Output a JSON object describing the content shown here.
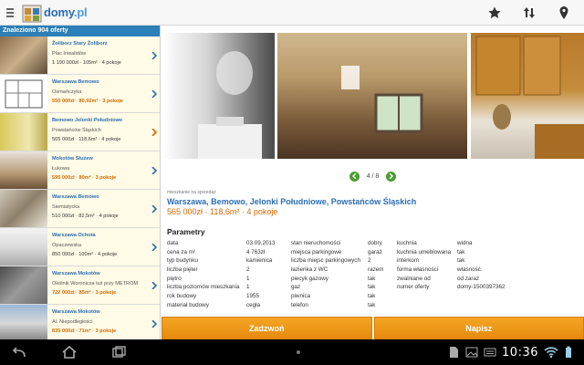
{
  "app": {
    "logo_text": "domy",
    "logo_suffix": ".pl"
  },
  "actionbar": {
    "icons": [
      "menu-icon",
      "star-icon",
      "sort-icon",
      "pin-icon"
    ]
  },
  "sidebar": {
    "header": "Znaleziono 904 oferty",
    "items": [
      {
        "title": "Żoliborz Stary Żoliborz",
        "sub": "Plac Inwalidów",
        "price": "1 190 000zł · 105m² · 4 pokoje",
        "highlight": false
      },
      {
        "title": "Warszawa Bemowo",
        "sub": "Osmańczyka",
        "price": "550 000zł · 80,92m² · 3 pokoje",
        "highlight": true
      },
      {
        "title": "Bemowo Jelonki Południowe",
        "sub": "Powstańców Śląskich",
        "price": "565 000zł · 118,6m² · 4 pokoje",
        "highlight": false
      },
      {
        "title": "Mokotów Służew",
        "sub": "Łukowa",
        "price": "595 000zł · 80m² · 3 pokoje",
        "highlight": true
      },
      {
        "title": "Warszawa Bemowo",
        "sub": "Siemiatycka",
        "price": "510 000zł · 82,5m² · 4 pokoje",
        "highlight": false
      },
      {
        "title": "Warszawa Ochota",
        "sub": "Opaczewska",
        "price": "850 000zł · 100m² · 4 pokoje",
        "highlight": false
      },
      {
        "title": "Warszawa Mokotów",
        "sub": "Okólnik Woronicza tuż przy METROM",
        "price": "722 000zł · 85m² · 3 pokoje",
        "highlight": true
      },
      {
        "title": "Warszawa Mokotów",
        "sub": "Al. Niepodległości",
        "price": "835 000zł · 71m² · 3 pokoje",
        "highlight": true
      }
    ]
  },
  "gallery": {
    "counter": "4 / 8"
  },
  "offer": {
    "type": "mieszkanie na sprzedaż",
    "title": "Warszawa, Bemowo, Jelonki Południowe, Powstańców Śląskich",
    "price": "565 000zł · 118,6m² · 4 pokoje"
  },
  "params": {
    "heading": "Parametry",
    "col1": [
      {
        "k": "data",
        "v": "03.09.2013"
      },
      {
        "k": "cena za m²",
        "v": "4 763zł"
      },
      {
        "k": "typ budynku",
        "v": "kamienica"
      },
      {
        "k": "liczba pięter",
        "v": "2"
      },
      {
        "k": "piętro",
        "v": "1"
      },
      {
        "k": "liczba poziomów mieszkania",
        "v": "1"
      },
      {
        "k": "rok budowy",
        "v": "1955"
      },
      {
        "k": "materiał budowy",
        "v": "cegła"
      }
    ],
    "col2": [
      {
        "k": "stan nieruchomości",
        "v": "dobry"
      },
      {
        "k": "miejsca parkingowe",
        "v": "garaż"
      },
      {
        "k": "liczba miejsc parkingowych",
        "v": "2"
      },
      {
        "k": "łazienka z WC",
        "v": "razem"
      },
      {
        "k": "piecyk gazowy",
        "v": "tak"
      },
      {
        "k": "gaz",
        "v": "tak"
      },
      {
        "k": "piwnica",
        "v": "tak"
      },
      {
        "k": "telefon",
        "v": "tak"
      }
    ],
    "col3": [
      {
        "k": "kuchnia",
        "v": "widna"
      },
      {
        "k": "kuchnia umeblowana",
        "v": "tak"
      },
      {
        "k": "interkom",
        "v": "tak"
      },
      {
        "k": "forma własności",
        "v": "własność"
      },
      {
        "k": "zwalniane od",
        "v": "od zaraz"
      },
      {
        "k": "numer oferty",
        "v": "domy-1500397362"
      }
    ]
  },
  "buttons": {
    "call": "Zadzwoń",
    "write": "Napisz"
  },
  "status": {
    "clock": "10:36"
  },
  "colors": {
    "brand": "#2b6db3",
    "accent": "#f5a623",
    "price": "#d36a00",
    "pager": "#4a9e2f"
  }
}
